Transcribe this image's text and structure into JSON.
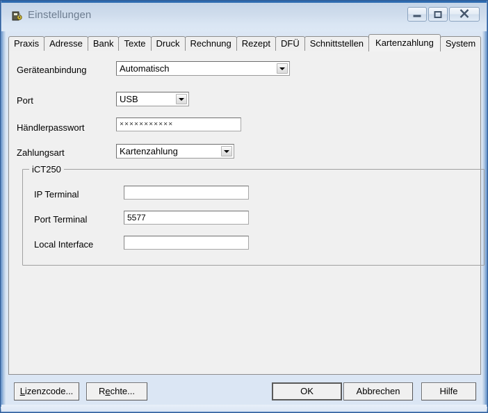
{
  "window": {
    "title": "Einstellungen",
    "icon": "app-icon",
    "controls": {
      "minimize": "minimize-button",
      "maximize": "maximize-button",
      "close": "close-button"
    },
    "accent_color": "#2e6bb0",
    "titlebar_color": "#cfdcec",
    "content_color": "#f0f0f0"
  },
  "tabs": [
    {
      "label": "Praxis",
      "active": false
    },
    {
      "label": "Adresse",
      "active": false
    },
    {
      "label": "Bank",
      "active": false
    },
    {
      "label": "Texte",
      "active": false
    },
    {
      "label": "Druck",
      "active": false
    },
    {
      "label": "Rechnung",
      "active": false
    },
    {
      "label": "Rezept",
      "active": false
    },
    {
      "label": "DFÜ",
      "active": false
    },
    {
      "label": "Schnittstellen",
      "active": false
    },
    {
      "label": "Kartenzahlung",
      "active": true
    },
    {
      "label": "System",
      "active": false
    }
  ],
  "form": {
    "geraeteanbindung": {
      "label": "Geräteanbindung",
      "value": "Automatisch"
    },
    "port": {
      "label": "Port",
      "value": "USB"
    },
    "haendlerpasswort": {
      "label": "Händlerpasswort",
      "value": "×××××××××××",
      "placeholder": ""
    },
    "zahlungsart": {
      "label": "Zahlungsart",
      "value": "Kartenzahlung"
    }
  },
  "groupbox": {
    "title": "iCT250",
    "fields": [
      {
        "label": "IP Terminal",
        "value": "",
        "placeholder": ""
      },
      {
        "label": "Port Terminal",
        "value": "5577",
        "placeholder": ""
      },
      {
        "label": "Local Interface",
        "value": "",
        "placeholder": ""
      }
    ]
  },
  "buttons": {
    "lizenzcode": {
      "accel": "L",
      "rest": "izenzcode..."
    },
    "rechte": {
      "pre": "R",
      "accel": "e",
      "rest": "chte..."
    },
    "ok": "OK",
    "abbrechen": "Abbrechen",
    "hilfe": "Hilfe"
  }
}
